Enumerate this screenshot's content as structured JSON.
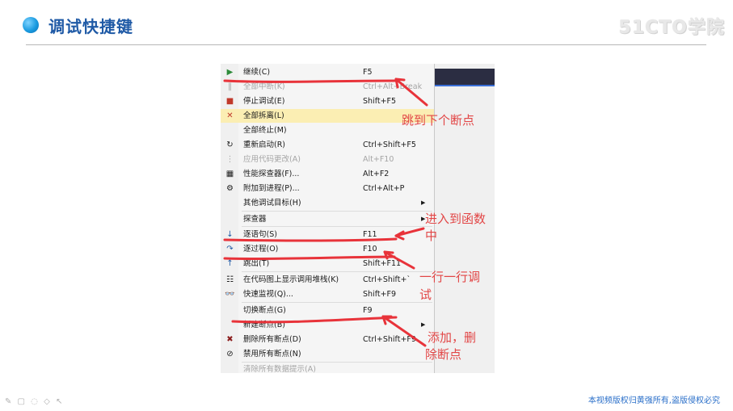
{
  "slide": {
    "title": "调试快捷键",
    "brand": "51CTO学院",
    "copyright": "本视频版权归黄强所有,盗版侵权必究",
    "tools": "✎ ▢ ◌ ◇ ↖"
  },
  "menu": {
    "items": [
      {
        "icon": "▶",
        "label": "继续(C)",
        "shortcut": "F5"
      },
      {
        "icon": "‖",
        "label": "全部中断(K)",
        "shortcut": "Ctrl+Alt+Break",
        "disabled": true
      },
      {
        "icon": "■",
        "label": "停止调试(E)",
        "shortcut": "Shift+F5"
      },
      {
        "icon": "✕",
        "label": "全部拆离(L)",
        "shortcut": ""
      },
      {
        "icon": "",
        "label": "全部终止(M)",
        "shortcut": ""
      },
      {
        "icon": "↻",
        "label": "重新启动(R)",
        "shortcut": "Ctrl+Shift+F5"
      },
      {
        "icon": "⋮",
        "label": "应用代码更改(A)",
        "shortcut": "Alt+F10",
        "disabled": true
      },
      {
        "icon": "▦",
        "label": "性能探查器(F)...",
        "shortcut": "Alt+F2"
      },
      {
        "icon": "⚙",
        "label": "附加到进程(P)...",
        "shortcut": "Ctrl+Alt+P"
      },
      {
        "icon": "",
        "label": "其他调试目标(H)",
        "shortcut": "",
        "arrow": "▶"
      },
      {
        "icon": "",
        "label": "探查器",
        "shortcut": "",
        "arrow": "▶"
      },
      {
        "icon": "↓",
        "label": "逐语句(S)",
        "shortcut": "F11"
      },
      {
        "icon": "↷",
        "label": "逐过程(O)",
        "shortcut": "F10"
      },
      {
        "icon": "↑",
        "label": "跳出(T)",
        "shortcut": "Shift+F11"
      },
      {
        "icon": "☷",
        "label": "在代码图上显示调用堆栈(K)",
        "shortcut": "Ctrl+Shift+`"
      },
      {
        "icon": "👓",
        "label": "快速监视(Q)...",
        "shortcut": "Shift+F9"
      },
      {
        "icon": "",
        "label": "切换断点(G)",
        "shortcut": "F9"
      },
      {
        "icon": "",
        "label": "新建断点(B)",
        "shortcut": "",
        "arrow": "▶"
      },
      {
        "icon": "✖",
        "label": "删除所有断点(D)",
        "shortcut": "Ctrl+Shift+F9"
      },
      {
        "icon": "⊘",
        "label": "禁用所有断点(N)",
        "shortcut": ""
      },
      {
        "icon": "",
        "label": "清除所有数据提示(A)",
        "shortcut": "",
        "disabled": true
      }
    ]
  },
  "annotations": {
    "next_breakpoint": "跳到下个断点",
    "step_into_1": "进入到函数",
    "step_into_2": "中",
    "step_over_1": "一行一行调",
    "step_over_2": "试",
    "breakpoint_1": "添加，删",
    "breakpoint_2": "除断点"
  },
  "colors": {
    "title": "#1f5aa6",
    "annotation": "#e24646",
    "highlight": "#fbeeb3",
    "copyright": "#2a6fc9"
  }
}
